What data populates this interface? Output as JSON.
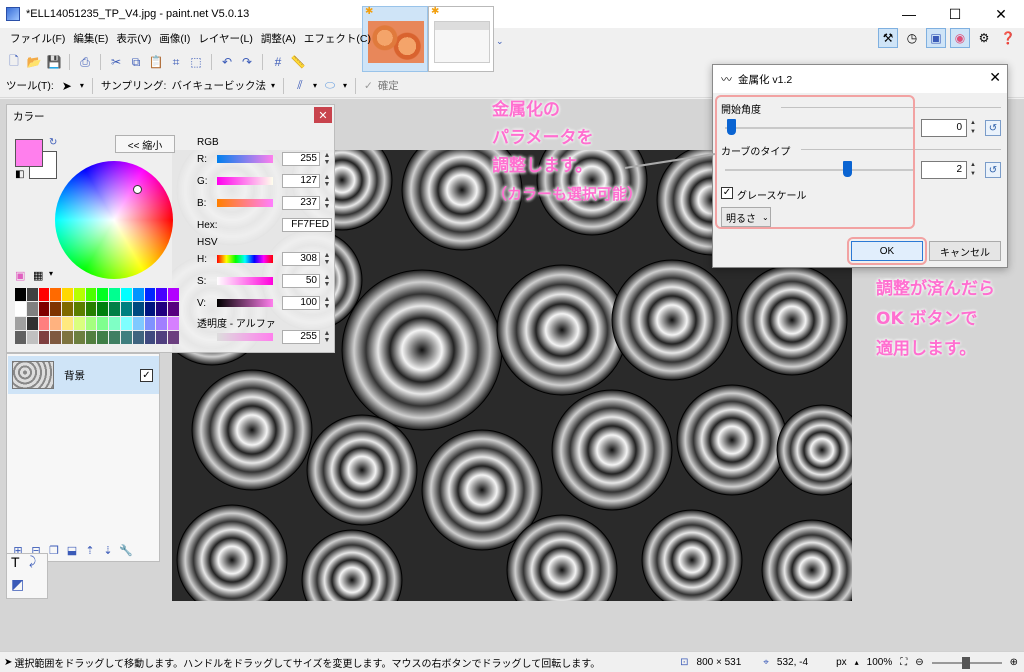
{
  "window": {
    "title": "*ELL14051235_TP_V4.jpg - paint.net V5.0.13",
    "controls": [
      "—",
      "☐",
      "✕"
    ]
  },
  "menu": [
    "ファイル(F)",
    "編集(E)",
    "表示(V)",
    "画像(I)",
    "レイヤー(L)",
    "調整(A)",
    "エフェクト(C)"
  ],
  "toolbar": {
    "tool_label": "ツール(T):",
    "sampling_label": "サンプリング:",
    "sampling_value": "バイキュービック法",
    "confirm_label": "確定"
  },
  "colors_panel": {
    "title": "カラー",
    "shrink_button": "<< 縮小",
    "rgb_label": "RGB",
    "r_label": "R:",
    "r_value": "255",
    "g_label": "G:",
    "g_value": "127",
    "b_label": "B:",
    "b_value": "237",
    "hex_label": "Hex:",
    "hex_value": "FF7FED",
    "hsv_label": "HSV",
    "h_label": "H:",
    "h_value": "308",
    "s_label": "S:",
    "s_value": "50",
    "v_label": "V:",
    "v_value": "100",
    "alpha_label": "透明度 - アルファ",
    "alpha_value": "255",
    "primary_color": "#FF7FED",
    "secondary_color": "#FFFFFF"
  },
  "layers_panel": {
    "layer_name": "背景",
    "visible": true
  },
  "dialog": {
    "title": "金属化 v1.2",
    "angle_label": "開始角度",
    "angle_value": "0",
    "curve_label": "カーブのタイプ",
    "curve_value": "2",
    "grayscale_label": "グレースケール",
    "grayscale_checked": true,
    "brightness_select": "明るさ",
    "ok_label": "OK",
    "cancel_label": "キャンセル"
  },
  "annotations": {
    "note1_line1": "金属化の",
    "note1_line2": "パラメータを",
    "note1_line3": "調整します。",
    "note1_line4": "（カラーも選択可能）",
    "note2_line1": "調整が済んだら",
    "note2_line2": "OK ボタンで",
    "note2_line3": "適用します。"
  },
  "statusbar": {
    "hint": "選択範囲をドラッグして移動します。ハンドルをドラッグしてサイズを変更します。マウスの右ボタンでドラッグして回転します。",
    "image_size": "800 × 531",
    "cursor_pos": "532, -4",
    "unit": "px",
    "zoom": "100%"
  }
}
